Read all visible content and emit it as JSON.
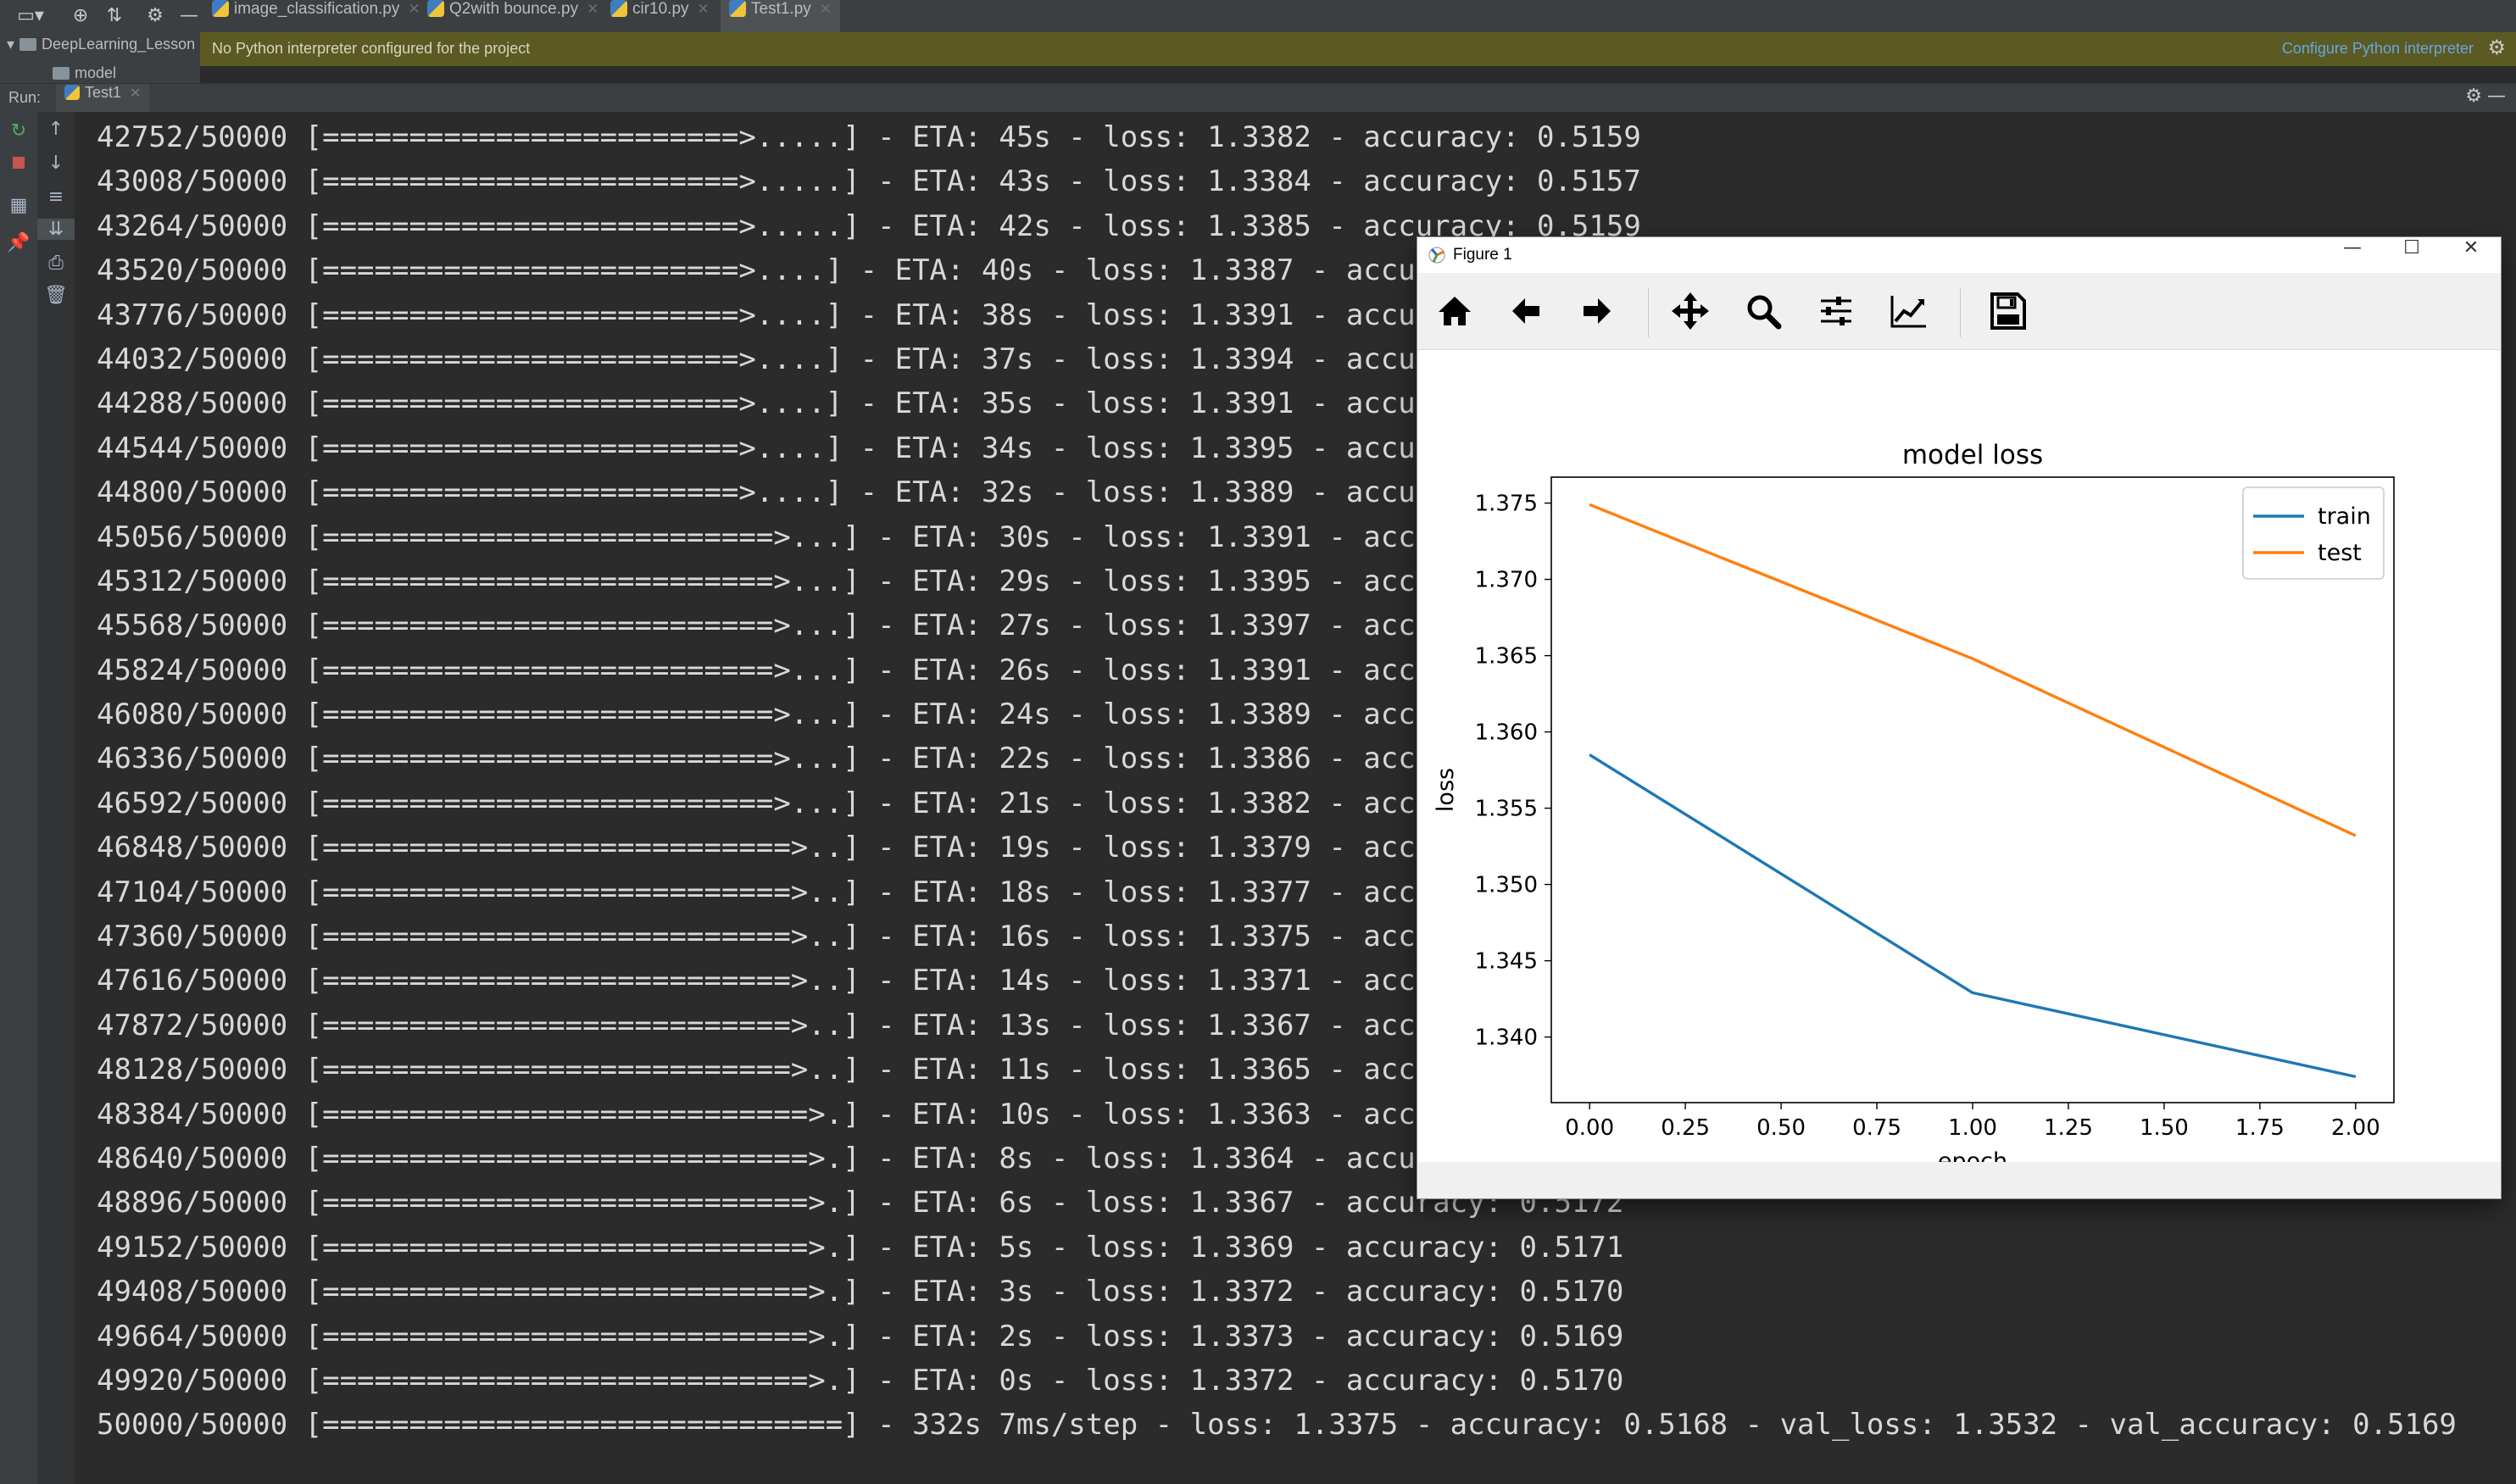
{
  "tabs": [
    {
      "label": "image_classification.py",
      "active": false
    },
    {
      "label": "Q2with bounce.py",
      "active": false
    },
    {
      "label": "cir10.py",
      "active": false
    },
    {
      "label": "Test1.py",
      "active": true
    }
  ],
  "project": {
    "root": "DeepLearning_Lesson",
    "child": "model",
    "notice": "No Python interpreter configured for the project",
    "configure_link": "Configure Python interpreter"
  },
  "run": {
    "label": "Run:",
    "config": "Test1"
  },
  "console_lines": [
    "42752/50000 [========================>.....] - ETA: 45s - loss: 1.3382 - accuracy: 0.5159",
    "43008/50000 [========================>.....] - ETA: 43s - loss: 1.3384 - accuracy: 0.5157",
    "43264/50000 [========================>.....] - ETA: 42s - loss: 1.3385 - accuracy: 0.5159",
    "43520/50000 [========================>....] - ETA: 40s - loss: 1.3387 - accur",
    "43776/50000 [========================>....] - ETA: 38s - loss: 1.3391 - accur",
    "44032/50000 [========================>....] - ETA: 37s - loss: 1.3394 - accur",
    "44288/50000 [========================>....] - ETA: 35s - loss: 1.3391 - accur",
    "44544/50000 [========================>....] - ETA: 34s - loss: 1.3395 - accur",
    "44800/50000 [========================>....] - ETA: 32s - loss: 1.3389 - accur",
    "45056/50000 [==========================>...] - ETA: 30s - loss: 1.3391 - accur",
    "45312/50000 [==========================>...] - ETA: 29s - loss: 1.3395 - accur",
    "45568/50000 [==========================>...] - ETA: 27s - loss: 1.3397 - accur",
    "45824/50000 [==========================>...] - ETA: 26s - loss: 1.3391 - accur",
    "46080/50000 [==========================>...] - ETA: 24s - loss: 1.3389 - accur",
    "46336/50000 [==========================>...] - ETA: 22s - loss: 1.3386 - accur",
    "46592/50000 [==========================>...] - ETA: 21s - loss: 1.3382 - accur",
    "46848/50000 [===========================>..] - ETA: 19s - loss: 1.3379 - accur",
    "47104/50000 [===========================>..] - ETA: 18s - loss: 1.3377 - accur",
    "47360/50000 [===========================>..] - ETA: 16s - loss: 1.3375 - accur",
    "47616/50000 [===========================>..] - ETA: 14s - loss: 1.3371 - accur",
    "47872/50000 [===========================>..] - ETA: 13s - loss: 1.3367 - accur",
    "48128/50000 [===========================>..] - ETA: 11s - loss: 1.3365 - accur",
    "48384/50000 [============================>.] - ETA: 10s - loss: 1.3363 - accur",
    "48640/50000 [============================>.] - ETA: 8s - loss: 1.3364 - accura",
    "48896/50000 [============================>.] - ETA: 6s - loss: 1.3367 - accuracy: 0.5172",
    "49152/50000 [============================>.] - ETA: 5s - loss: 1.3369 - accuracy: 0.5171",
    "49408/50000 [============================>.] - ETA: 3s - loss: 1.3372 - accuracy: 0.5170",
    "49664/50000 [============================>.] - ETA: 2s - loss: 1.3373 - accuracy: 0.5169",
    "49920/50000 [============================>.] - ETA: 0s - loss: 1.3372 - accuracy: 0.5170",
    "50000/50000 [==============================] - 332s 7ms/step - loss: 1.3375 - accuracy: 0.5168 - val_loss: 1.3532 - val_accuracy: 0.5169"
  ],
  "figure": {
    "window_title": "Figure 1",
    "toolbar_icons": [
      "home-icon",
      "back-arrow-icon",
      "forward-arrow-icon",
      "pan-icon",
      "zoom-icon",
      "configure-subplots-icon",
      "edit-axes-icon",
      "save-icon"
    ]
  },
  "chart_data": {
    "type": "line",
    "title": "model loss",
    "xlabel": "epoch",
    "ylabel": "loss",
    "x": [
      0,
      1,
      2
    ],
    "series": [
      {
        "name": "train",
        "values": [
          1.3585,
          1.3429,
          1.3374
        ],
        "color": "#1f77b4"
      },
      {
        "name": "test",
        "values": [
          1.3749,
          1.3648,
          1.3532
        ],
        "color": "#ff7f0e"
      }
    ],
    "xlim": [
      -0.1,
      2.1
    ],
    "ylim": [
      1.3357,
      1.3767
    ],
    "xticks": [
      "0.00",
      "0.25",
      "0.50",
      "0.75",
      "1.00",
      "1.25",
      "1.50",
      "1.75",
      "2.00"
    ],
    "yticks": [
      "1.340",
      "1.345",
      "1.350",
      "1.355",
      "1.360",
      "1.365",
      "1.370",
      "1.375"
    ],
    "legend_position": "upper right",
    "grid": false
  }
}
